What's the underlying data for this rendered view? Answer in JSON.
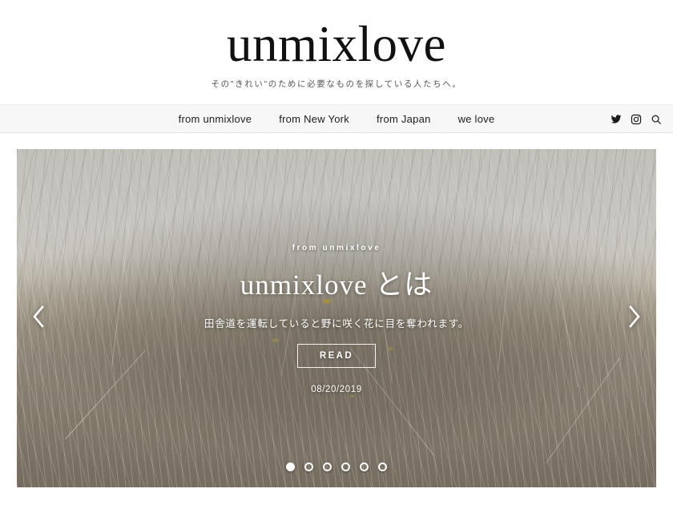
{
  "header": {
    "logo": "unmixlove",
    "tagline": "その\"きれい\"のために必要なものを探している人たちへ。"
  },
  "nav": {
    "items": [
      {
        "label": "from unmixlove"
      },
      {
        "label": "from New York"
      },
      {
        "label": "from Japan"
      },
      {
        "label": "we love"
      }
    ],
    "social": [
      {
        "name": "twitter-icon"
      },
      {
        "name": "instagram-icon"
      },
      {
        "name": "search-icon"
      }
    ]
  },
  "hero": {
    "category": "from unmixlove",
    "title": "unmixlove とは",
    "excerpt": "田舎道を運転していると野に咲く花に目を奪われます。",
    "read_label": "READ",
    "date": "08/20/2019",
    "prev_label": "‹",
    "next_label": "›",
    "dots": [
      {
        "active": true
      },
      {
        "active": false
      },
      {
        "active": false
      },
      {
        "active": false
      },
      {
        "active": false
      },
      {
        "active": false
      }
    ]
  },
  "colors": {
    "text": "#111111",
    "nav_bg": "#f7f7f7",
    "hero_sky": "#c9c7c2",
    "hero_field": "#8d8273",
    "accent_white": "#ffffff",
    "flower_yellow": "#e0c43c"
  }
}
